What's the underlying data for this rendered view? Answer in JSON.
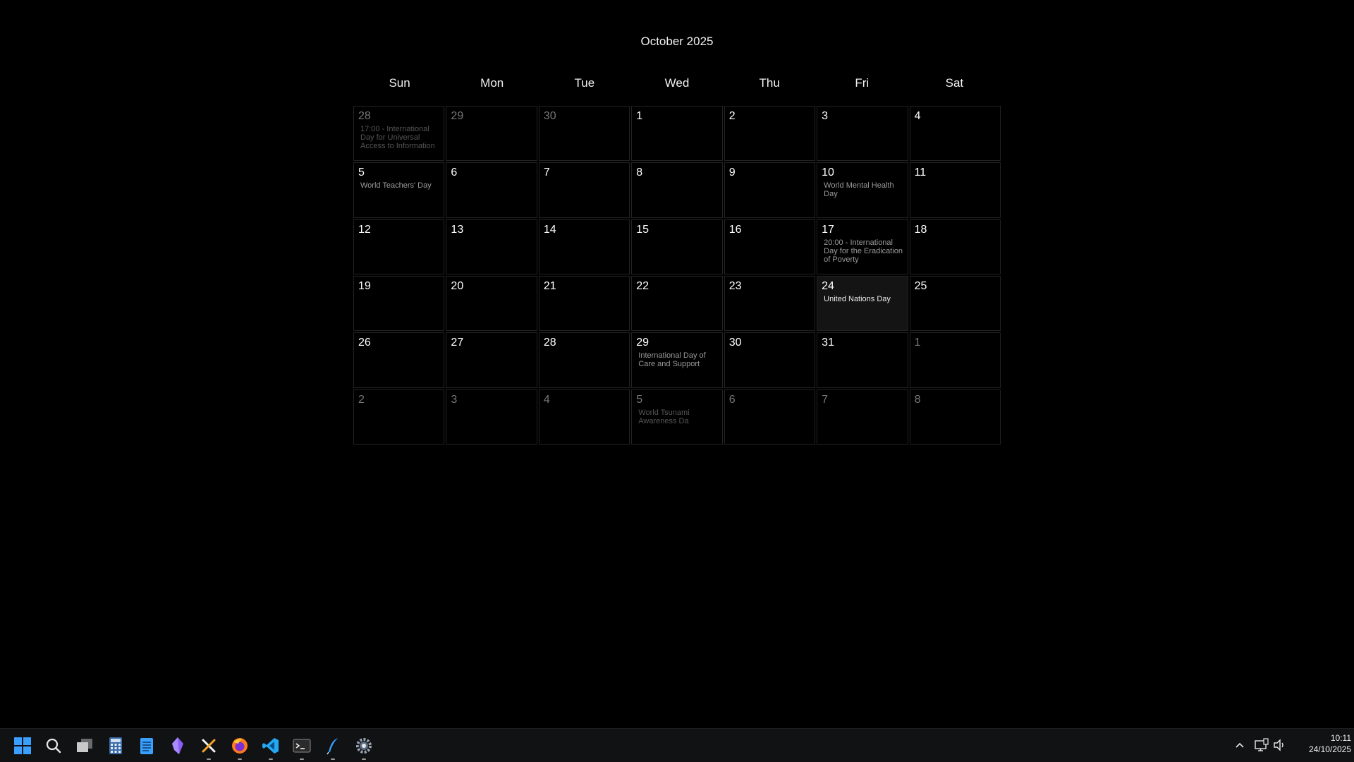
{
  "calendar": {
    "title": "October 2025",
    "weekdays": [
      "Sun",
      "Mon",
      "Tue",
      "Wed",
      "Thu",
      "Fri",
      "Sat"
    ],
    "days": [
      {
        "day": "28",
        "other_month": true,
        "event": "17:00 - International Day for Universal Access to Information"
      },
      {
        "day": "29",
        "other_month": true,
        "event": ""
      },
      {
        "day": "30",
        "other_month": true,
        "event": ""
      },
      {
        "day": "1",
        "other_month": false,
        "event": ""
      },
      {
        "day": "2",
        "other_month": false,
        "event": ""
      },
      {
        "day": "3",
        "other_month": false,
        "event": ""
      },
      {
        "day": "4",
        "other_month": false,
        "event": ""
      },
      {
        "day": "5",
        "other_month": false,
        "event": "World Teachers' Day"
      },
      {
        "day": "6",
        "other_month": false,
        "event": ""
      },
      {
        "day": "7",
        "other_month": false,
        "event": ""
      },
      {
        "day": "8",
        "other_month": false,
        "event": ""
      },
      {
        "day": "9",
        "other_month": false,
        "event": ""
      },
      {
        "day": "10",
        "other_month": false,
        "event": "World Mental Health Day"
      },
      {
        "day": "11",
        "other_month": false,
        "event": ""
      },
      {
        "day": "12",
        "other_month": false,
        "event": ""
      },
      {
        "day": "13",
        "other_month": false,
        "event": ""
      },
      {
        "day": "14",
        "other_month": false,
        "event": ""
      },
      {
        "day": "15",
        "other_month": false,
        "event": ""
      },
      {
        "day": "16",
        "other_month": false,
        "event": ""
      },
      {
        "day": "17",
        "other_month": false,
        "event": "20:00 - International Day for the Eradication of Poverty"
      },
      {
        "day": "18",
        "other_month": false,
        "event": ""
      },
      {
        "day": "19",
        "other_month": false,
        "event": ""
      },
      {
        "day": "20",
        "other_month": false,
        "event": ""
      },
      {
        "day": "21",
        "other_month": false,
        "event": ""
      },
      {
        "day": "22",
        "other_month": false,
        "event": ""
      },
      {
        "day": "23",
        "other_month": false,
        "event": ""
      },
      {
        "day": "24",
        "other_month": false,
        "today": true,
        "event": "United Nations Day"
      },
      {
        "day": "25",
        "other_month": false,
        "event": ""
      },
      {
        "day": "26",
        "other_month": false,
        "event": ""
      },
      {
        "day": "27",
        "other_month": false,
        "event": ""
      },
      {
        "day": "28",
        "other_month": false,
        "event": ""
      },
      {
        "day": "29",
        "other_month": false,
        "event": "International Day of Care and Support"
      },
      {
        "day": "30",
        "other_month": false,
        "event": ""
      },
      {
        "day": "31",
        "other_month": false,
        "event": ""
      },
      {
        "day": "1",
        "other_month": true,
        "event": ""
      },
      {
        "day": "2",
        "other_month": true,
        "event": ""
      },
      {
        "day": "3",
        "other_month": true,
        "event": ""
      },
      {
        "day": "4",
        "other_month": true,
        "event": ""
      },
      {
        "day": "5",
        "other_month": true,
        "event": "World Tsunami Awareness Da"
      },
      {
        "day": "6",
        "other_month": true,
        "event": ""
      },
      {
        "day": "7",
        "other_month": true,
        "event": ""
      },
      {
        "day": "8",
        "other_month": true,
        "event": ""
      }
    ]
  },
  "taskbar": {
    "apps": [
      {
        "name": "start",
        "icon": "windows-start-icon",
        "running": false
      },
      {
        "name": "search",
        "icon": "search-icon",
        "running": false
      },
      {
        "name": "task-view",
        "icon": "task-view-icon",
        "running": false
      },
      {
        "name": "calculator",
        "icon": "calculator-icon",
        "running": false
      },
      {
        "name": "notepad",
        "icon": "notepad-icon",
        "running": false
      },
      {
        "name": "app-purple",
        "icon": "purple-gem-icon",
        "running": false
      },
      {
        "name": "tools",
        "icon": "tools-icon",
        "running": true
      },
      {
        "name": "firefox",
        "icon": "firefox-icon",
        "running": true
      },
      {
        "name": "vscode",
        "icon": "vscode-icon",
        "running": true
      },
      {
        "name": "terminal",
        "icon": "terminal-icon",
        "running": true
      },
      {
        "name": "feather-app",
        "icon": "feather-icon",
        "running": true
      },
      {
        "name": "settings",
        "icon": "settings-gear-icon",
        "running": true
      }
    ],
    "clock": {
      "time": "10:11",
      "date": "24/10/2025"
    },
    "tray": {
      "chevron_icon": "chevron-up-icon",
      "network_icon": "network-icon",
      "volume_icon": "volume-icon"
    },
    "colors": {
      "accent_blue": "#3aa0ff",
      "vscode_blue": "#23a9f2",
      "firefox_orange": "#ff7a1a",
      "purple": "#8b5cf6"
    }
  }
}
